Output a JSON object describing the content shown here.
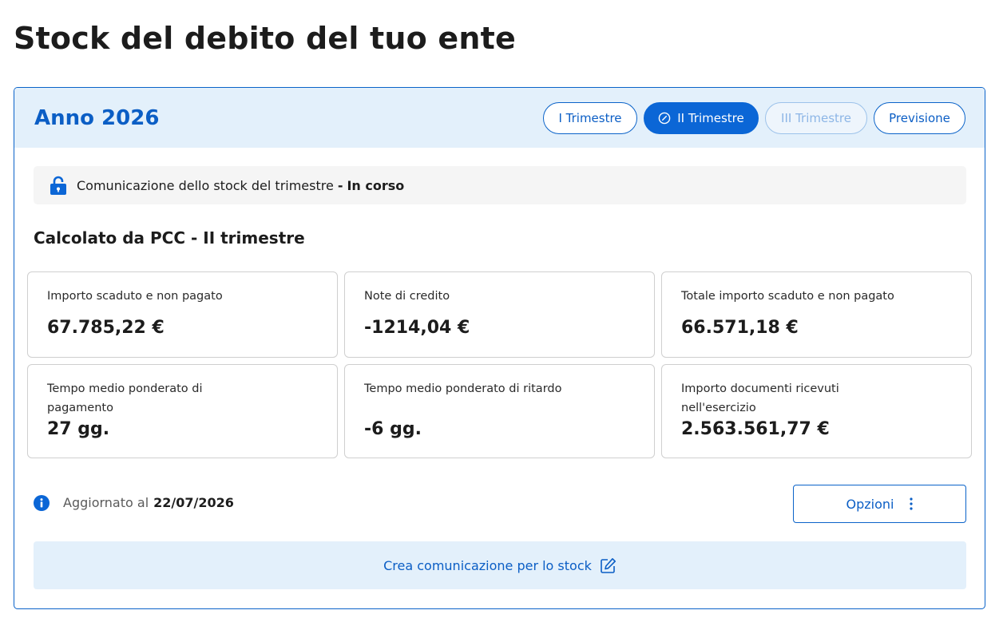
{
  "page": {
    "title": "Stock del debito del tuo ente"
  },
  "header": {
    "year_title": "Anno 2026",
    "tabs": [
      {
        "label": "I Trimestre",
        "state": "default"
      },
      {
        "label": "II Trimestre",
        "state": "active"
      },
      {
        "label": "III Trimestre",
        "state": "disabled"
      },
      {
        "label": "Previsione",
        "state": "default"
      }
    ]
  },
  "status": {
    "icon": "lock-icon",
    "text": "Comunicazione dello stock del trimestre",
    "separator": "-",
    "value": "In corso"
  },
  "section": {
    "title": "Calcolato da PCC - II trimestre"
  },
  "tiles": [
    {
      "label": "Importo scaduto e non pagato",
      "value": "67.785,22 €"
    },
    {
      "label": "Note di credito",
      "value": "-1214,04 €"
    },
    {
      "label": "Totale importo scaduto e non pagato",
      "value": "66.571,18 €"
    },
    {
      "label_line1": "Tempo medio ponderato di",
      "label_line2": "pagamento",
      "value": "27 gg."
    },
    {
      "label": "Tempo medio ponderato di ritardo",
      "value": "-6 gg."
    },
    {
      "label_line1": "Importo documenti ricevuti",
      "label_line2": "nell'esercizio",
      "value": "2.563.561,77 €"
    }
  ],
  "footer": {
    "updated_label": "Aggiornato al",
    "updated_date": "22/07/2026",
    "options_label": "Opzioni",
    "create_label": "Crea comunicazione per lo stock"
  },
  "colors": {
    "primary": "#0b66d6",
    "header_bg": "#e3f0fb",
    "text": "#1c1c1c"
  }
}
